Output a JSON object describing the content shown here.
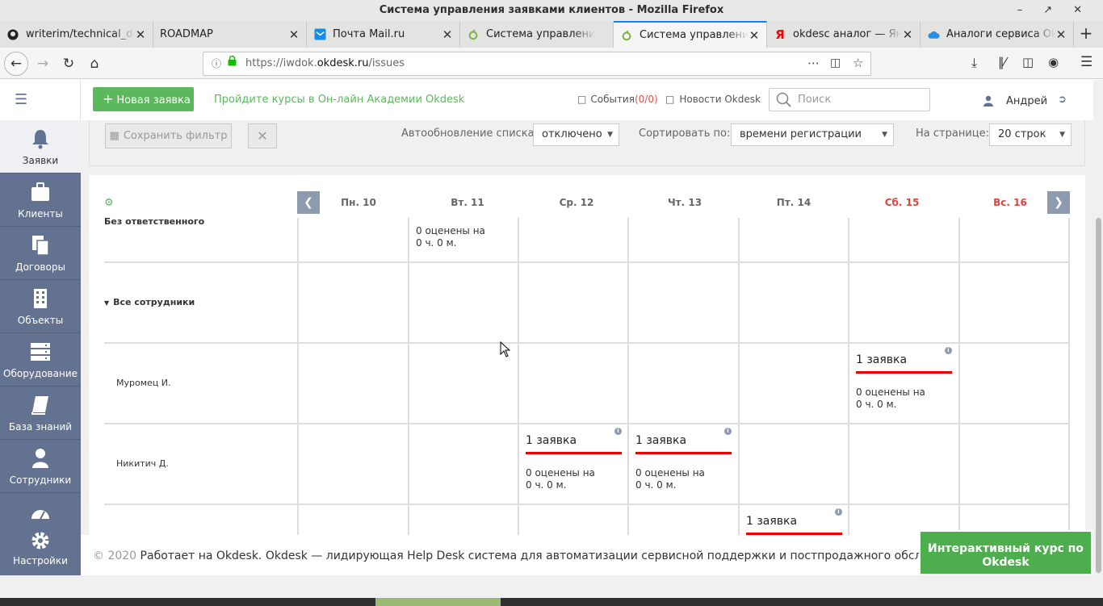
{
  "window": {
    "title": "Система управления заявками клиентов - Mozilla Firefox"
  },
  "tabs": [
    {
      "label": "writerim/technical_do",
      "icon": "github-icon"
    },
    {
      "label": "ROADMAP",
      "icon": "none"
    },
    {
      "label": "Почта Mail.ru",
      "icon": "mail-icon"
    },
    {
      "label": "Система управления",
      "icon": "okdesk-icon"
    },
    {
      "label": "Система управления",
      "icon": "okdesk-icon",
      "active": true
    },
    {
      "label": "okdesc аналог — Янд",
      "icon": "yandex-icon"
    },
    {
      "label": "Аналоги сервиса Okd",
      "icon": "cloud-icon"
    }
  ],
  "url": {
    "prefix": "https://iwdok.",
    "domain": "okdesk.ru",
    "path": "/issues"
  },
  "sidebar": [
    {
      "label": "Заявки",
      "icon": "bell-icon"
    },
    {
      "label": "Клиенты",
      "icon": "briefcase-icon"
    },
    {
      "label": "Договоры",
      "icon": "documents-icon"
    },
    {
      "label": "Объекты",
      "icon": "building-icon"
    },
    {
      "label": "Оборудование",
      "icon": "server-icon"
    },
    {
      "label": "База знаний",
      "icon": "book-icon"
    },
    {
      "label": "Сотрудники",
      "icon": "person-icon"
    },
    {
      "label": "Настройки",
      "icon": "gear-icon"
    }
  ],
  "header": {
    "new_ticket": "Новая заявка",
    "promo": "Пройдите курсы в Он-лайн Академии Okdesk",
    "events_label": "События",
    "events_count": "(0/0)",
    "news": "Новости Okdesk",
    "search_placeholder": "Поиск",
    "user": "Андрей"
  },
  "filters": {
    "save": "Сохранить фильтр",
    "autorefresh_label": "Автообновление списка:",
    "autorefresh_value": "отключено",
    "sort_label": "Сортировать по:",
    "sort_value": "времени регистрации",
    "perpage_label": "На странице:",
    "perpage_value": "20 строк"
  },
  "calendar": {
    "days": [
      "Пн. 10",
      "Вт. 11",
      "Ср. 12",
      "Чт. 13",
      "Пт. 14",
      "Сб. 15",
      "Вс. 16"
    ],
    "rows": {
      "unassigned": "Без ответственного",
      "all_staff": "Все сотрудники",
      "muromets": "Муромец И.",
      "nikitich": "Никитич Д."
    },
    "note_line1": "0 оценены на",
    "note_line2": "0 ч. 0 м.",
    "ticket_label": "1 заявка"
  },
  "footer": {
    "copyright": "© 2020",
    "text": "Работает на Okdesk. Okdesk — лидирующая Help Desk система для автоматизации сервисной поддержки и постпродажного обслуживания"
  },
  "course_button": "Интерактивный курс по Okdesk"
}
